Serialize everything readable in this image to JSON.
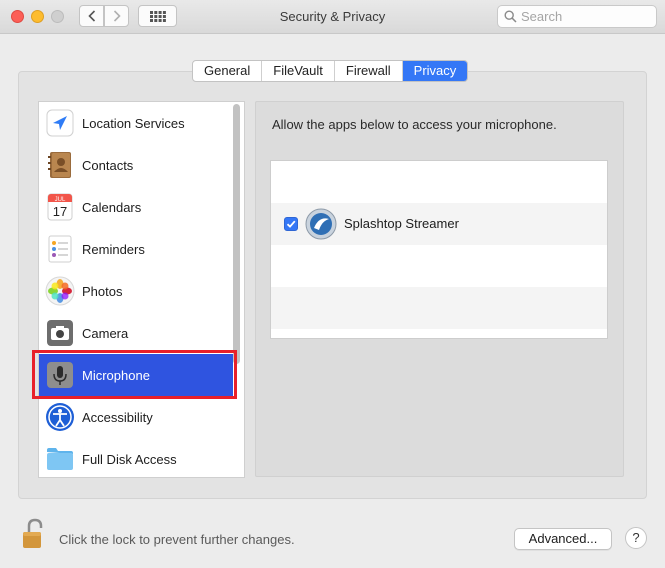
{
  "window": {
    "title": "Security & Privacy",
    "search_placeholder": "Search"
  },
  "tabs": [
    {
      "label": "General",
      "active": false
    },
    {
      "label": "FileVault",
      "active": false
    },
    {
      "label": "Firewall",
      "active": false
    },
    {
      "label": "Privacy",
      "active": true
    }
  ],
  "sidebar": {
    "items": [
      {
        "label": "Location Services",
        "icon": "location-arrow-icon"
      },
      {
        "label": "Contacts",
        "icon": "contacts-book-icon"
      },
      {
        "label": "Calendars",
        "icon": "calendar-icon",
        "icon_month": "JUL",
        "icon_day": "17"
      },
      {
        "label": "Reminders",
        "icon": "reminders-list-icon"
      },
      {
        "label": "Photos",
        "icon": "photos-flower-icon"
      },
      {
        "label": "Camera",
        "icon": "camera-icon"
      },
      {
        "label": "Microphone",
        "icon": "microphone-icon",
        "selected": true
      },
      {
        "label": "Accessibility",
        "icon": "accessibility-icon"
      },
      {
        "label": "Full Disk Access",
        "icon": "folder-icon"
      }
    ]
  },
  "main": {
    "caption": "Allow the apps below to access your microphone.",
    "apps": [
      {
        "name": "Splashtop Streamer",
        "checked": true,
        "icon": "splashtop-icon"
      }
    ]
  },
  "footer": {
    "lock_text": "Click the lock to prevent further changes.",
    "advanced_label": "Advanced...",
    "help_label": "?"
  },
  "colors": {
    "accent": "#3477f6",
    "selection": "#2f54e0",
    "highlight_box": "#e8202a"
  }
}
